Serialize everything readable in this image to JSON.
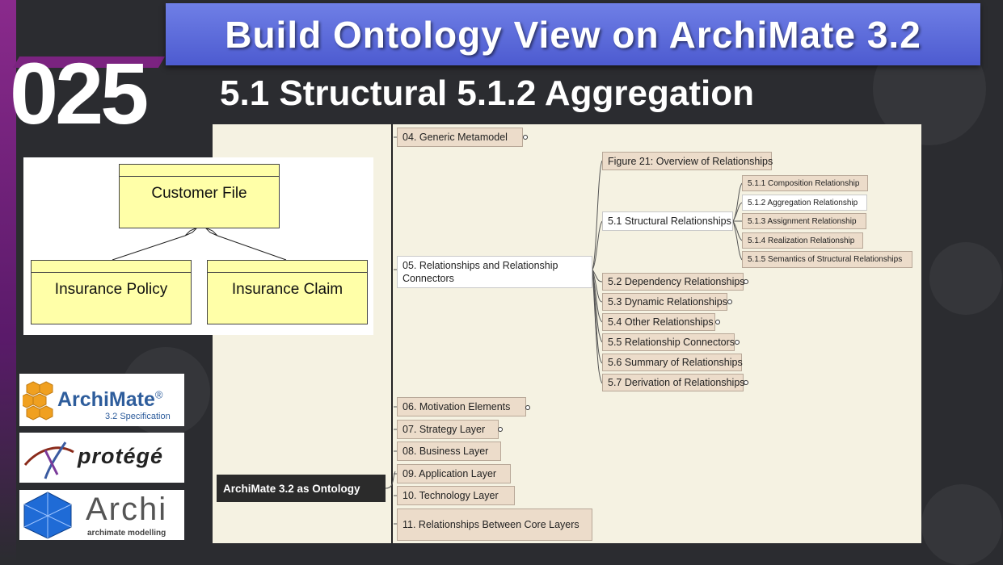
{
  "slide": {
    "title": "Build Ontology View on ArchiMate 3.2",
    "number": "025",
    "subtitle": "5.1 Structural 5.1.2 Aggregation"
  },
  "diagram": {
    "parent": "Customer File",
    "child1": "Insurance Policy",
    "child2": "Insurance Claim"
  },
  "mindmap": {
    "root": "ArchiMate 3.2 as Ontology",
    "nodes": {
      "n04": "04. Generic Metamodel",
      "n05": "05. Relationships and Relationship Connectors",
      "fig21": "Figure 21: Overview of Relationships",
      "s51": "5.1 Structural Relationships",
      "s511": "5.1.1 Composition Relationship",
      "s512": "5.1.2 Aggregation Relationship",
      "s513": "5.1.3 Assignment Relationship",
      "s514": "5.1.4 Realization Relationship",
      "s515": "5.1.5 Semantics of Structural Relationships",
      "s52": "5.2 Dependency Relationships",
      "s53": "5.3 Dynamic Relationships",
      "s54": "5.4 Other Relationships",
      "s55": "5.5 Relationship Connectors",
      "s56": "5.6 Summary of Relationships",
      "s57": "5.7 Derivation of Relationships",
      "n06": "06. Motivation Elements",
      "n07": "07. Strategy Layer",
      "n08": "08. Business Layer",
      "n09": "09. Application Layer",
      "n10": "10. Technology Layer",
      "n11": "11. Relationships Between Core Layers"
    }
  },
  "logos": {
    "archimate": "ArchiMate",
    "archimate_reg": "®",
    "archimate_sub": "3.2 Specification",
    "protege": "protégé",
    "archi": "Archi",
    "archi_sub": "archimate modelling"
  }
}
